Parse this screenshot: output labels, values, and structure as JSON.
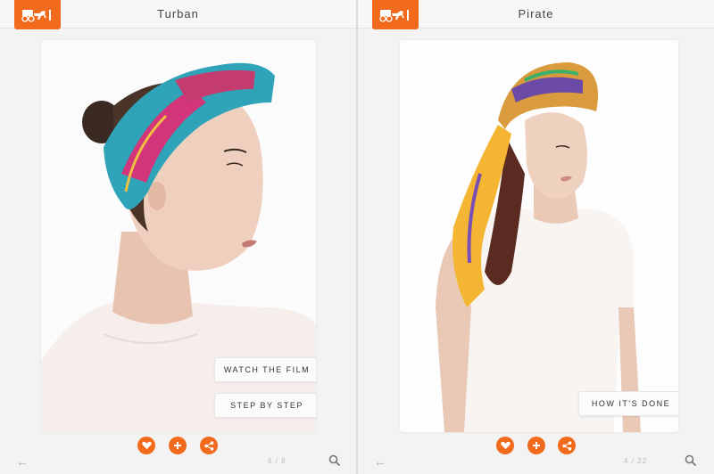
{
  "left_screen": {
    "title": "Turban",
    "buttons": {
      "watch_film": "WATCH THE FILM",
      "step_by_step": "STEP BY STEP"
    },
    "pager": "6 / 8"
  },
  "right_screen": {
    "title": "Pirate",
    "buttons": {
      "how_done": "HOW IT'S DONE"
    },
    "pager": "4 / 22"
  },
  "colors": {
    "brand": "#f26b1d",
    "background": "#f3f3f3"
  },
  "icons": [
    "logo-carriage-icon",
    "heart-icon",
    "plus-icon",
    "share-icon",
    "back-arrow-icon",
    "search-icon"
  ]
}
